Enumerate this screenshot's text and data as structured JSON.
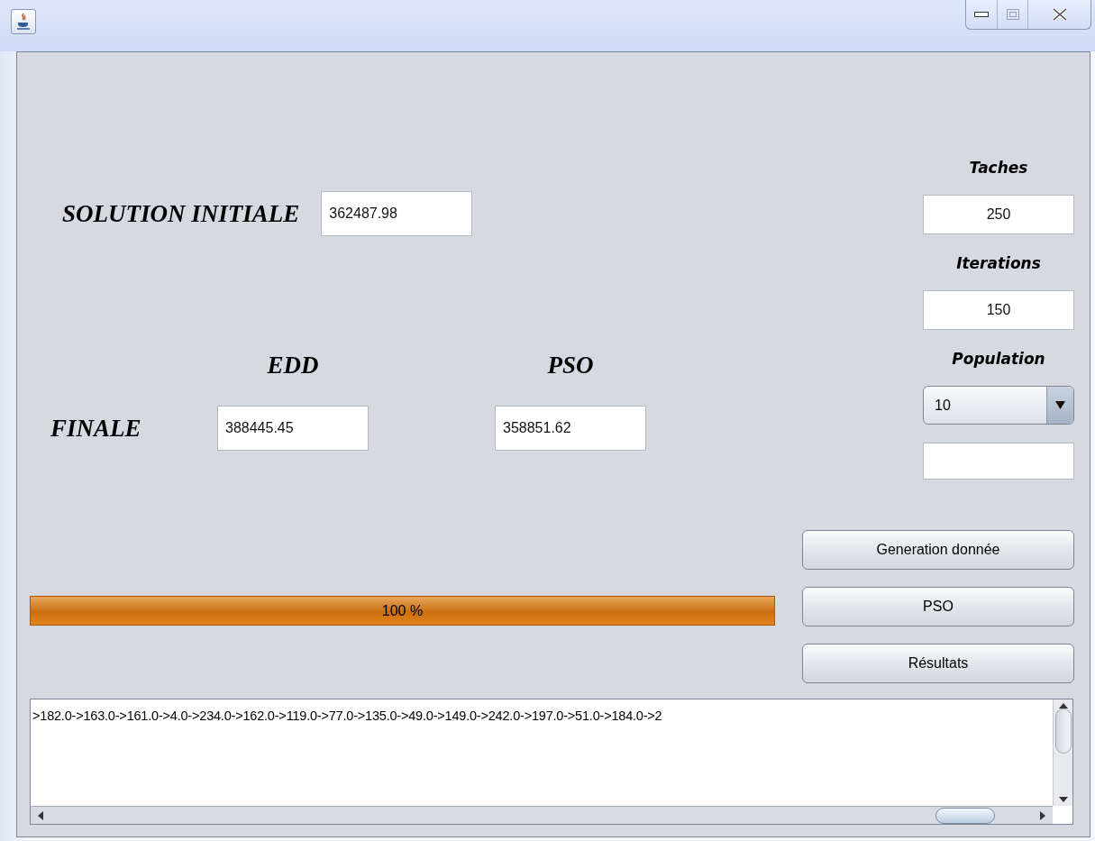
{
  "solution_initiale": {
    "label": "SOLUTION INITIALE",
    "value": "362487.98"
  },
  "finale": {
    "label": "FINALE",
    "columns": [
      {
        "header": "EDD",
        "value": "388445.45"
      },
      {
        "header": "PSO",
        "value": "358851.62"
      }
    ]
  },
  "params": [
    {
      "kind": "field",
      "label": "Taches",
      "value": "250"
    },
    {
      "kind": "field",
      "label": "Iterations",
      "value": "150"
    },
    {
      "kind": "combo",
      "label": "Population",
      "value": "10"
    }
  ],
  "progress": {
    "level": 1,
    "text": "100 %"
  },
  "buttons": [
    "Generation donnée",
    "PSO",
    "Résultats"
  ],
  "output": {
    "text": ">182.0->163.0->161.0->4.0->234.0->162.0->119.0->77.0->135.0->49.0->149.0->242.0->197.0->51.0->184.0->2"
  }
}
